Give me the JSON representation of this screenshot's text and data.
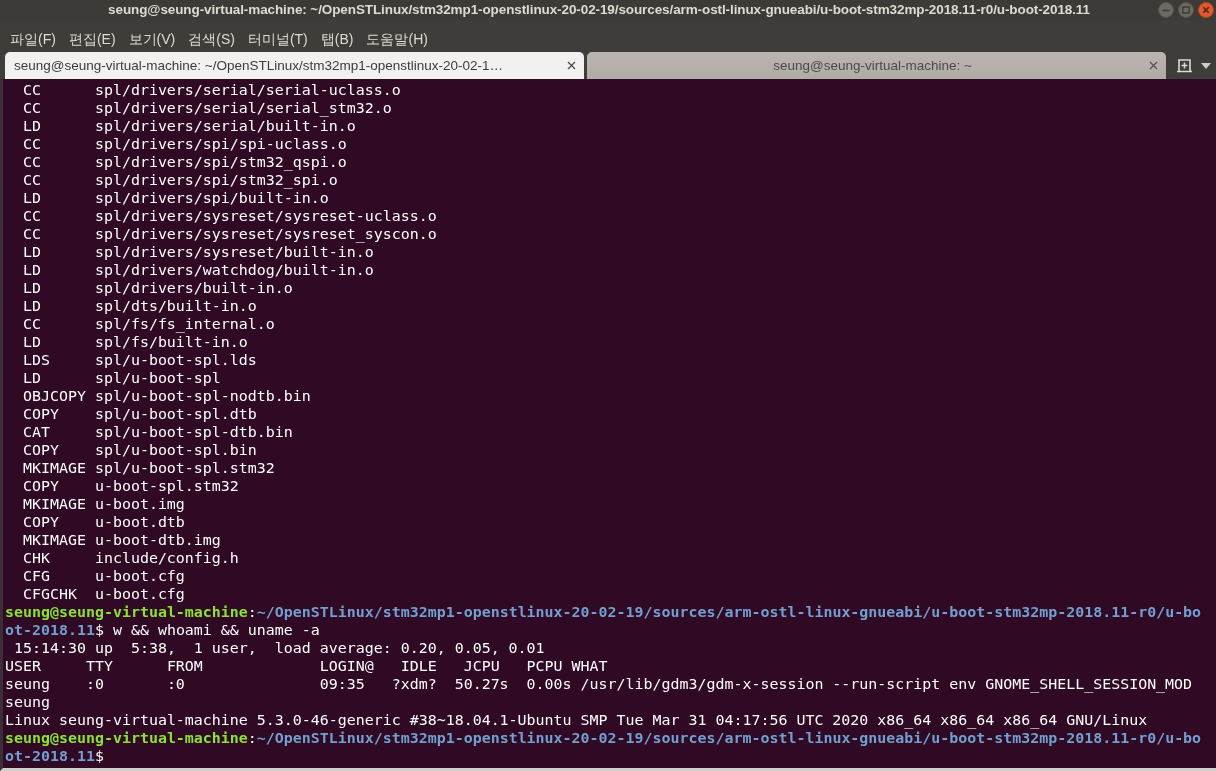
{
  "window": {
    "title": "seung@seung-virtual-machine: ~/OpenSTLinux/stm32mp1-openstlinux-20-02-19/sources/arm-ostl-linux-gnueabi/u-boot-stm32mp-2018.11-r0/u-boot-2018.11"
  },
  "menu": [
    "파일(F)",
    "편집(E)",
    "보기(V)",
    "검색(S)",
    "터미널(T)",
    "탭(B)",
    "도움말(H)"
  ],
  "tabs": [
    {
      "label": "seung@seung-virtual-machine: ~/OpenSTLinux/stm32mp1-openstlinux-20-02-1…",
      "selected": true
    },
    {
      "label": "seung@seung-virtual-machine: ~",
      "selected": false
    }
  ],
  "terminal": {
    "lines": [
      {
        "kind": "build",
        "text": "CC      spl/drivers/serial/serial-uclass.o"
      },
      {
        "kind": "build",
        "text": "CC      spl/drivers/serial/serial_stm32.o"
      },
      {
        "kind": "build",
        "text": "LD      spl/drivers/serial/built-in.o"
      },
      {
        "kind": "build",
        "text": "CC      spl/drivers/spi/spi-uclass.o"
      },
      {
        "kind": "build",
        "text": "CC      spl/drivers/spi/stm32_qspi.o"
      },
      {
        "kind": "build",
        "text": "CC      spl/drivers/spi/stm32_spi.o"
      },
      {
        "kind": "build",
        "text": "LD      spl/drivers/spi/built-in.o"
      },
      {
        "kind": "build",
        "text": "CC      spl/drivers/sysreset/sysreset-uclass.o"
      },
      {
        "kind": "build",
        "text": "CC      spl/drivers/sysreset/sysreset_syscon.o"
      },
      {
        "kind": "build",
        "text": "LD      spl/drivers/sysreset/built-in.o"
      },
      {
        "kind": "build",
        "text": "LD      spl/drivers/watchdog/built-in.o"
      },
      {
        "kind": "build",
        "text": "LD      spl/drivers/built-in.o"
      },
      {
        "kind": "build",
        "text": "LD      spl/dts/built-in.o"
      },
      {
        "kind": "build",
        "text": "CC      spl/fs/fs_internal.o"
      },
      {
        "kind": "build",
        "text": "LD      spl/fs/built-in.o"
      },
      {
        "kind": "build",
        "text": "LDS     spl/u-boot-spl.lds"
      },
      {
        "kind": "build",
        "text": "LD      spl/u-boot-spl"
      },
      {
        "kind": "build",
        "text": "OBJCOPY spl/u-boot-spl-nodtb.bin"
      },
      {
        "kind": "build",
        "text": "COPY    spl/u-boot-spl.dtb"
      },
      {
        "kind": "build",
        "text": "CAT     spl/u-boot-spl-dtb.bin"
      },
      {
        "kind": "build",
        "text": "COPY    spl/u-boot-spl.bin"
      },
      {
        "kind": "build",
        "text": "MKIMAGE spl/u-boot-spl.stm32"
      },
      {
        "kind": "build",
        "text": "COPY    u-boot-spl.stm32"
      },
      {
        "kind": "build",
        "text": "MKIMAGE u-boot.img"
      },
      {
        "kind": "build",
        "text": "COPY    u-boot.dtb"
      },
      {
        "kind": "build",
        "text": "MKIMAGE u-boot-dtb.img"
      },
      {
        "kind": "build",
        "text": "CHK     include/config.h"
      },
      {
        "kind": "build",
        "text": "CFG     u-boot.cfg"
      },
      {
        "kind": "build",
        "text": "CFGCHK  u-boot.cfg"
      },
      {
        "kind": "prompt",
        "segments": [
          {
            "kind": "user",
            "text": "seung@seung-virtual-machine"
          },
          {
            "kind": "plain",
            "text": ":"
          },
          {
            "kind": "path",
            "text": "~/OpenSTLinux/stm32mp1-openstlinux-20-02-19/sources/arm-ostl-linux-gnueabi/u-boot-stm32mp-2018.11-r0/u-bo"
          }
        ]
      },
      {
        "kind": "prompt",
        "segments": [
          {
            "kind": "path",
            "text": "ot-2018.11"
          },
          {
            "kind": "plain",
            "text": "$ w && whoami && uname -a"
          }
        ]
      },
      {
        "kind": "output",
        "text": " 15:14:30 up  5:38,  1 user,  load average: 0.20, 0.05, 0.01"
      },
      {
        "kind": "output",
        "text": "USER     TTY      FROM             LOGIN@   IDLE   JCPU   PCPU WHAT"
      },
      {
        "kind": "output",
        "text": "seung    :0       :0               09:35   ?xdm?  50.27s  0.00s /usr/lib/gdm3/gdm-x-session --run-script env GNOME_SHELL_SESSION_MOD"
      },
      {
        "kind": "output",
        "text": "seung"
      },
      {
        "kind": "output",
        "text": "Linux seung-virtual-machine 5.3.0-46-generic #38~18.04.1-Ubuntu SMP Tue Mar 31 04:17:56 UTC 2020 x86_64 x86_64 x86_64 GNU/Linux"
      },
      {
        "kind": "prompt",
        "segments": [
          {
            "kind": "user",
            "text": "seung@seung-virtual-machine"
          },
          {
            "kind": "plain",
            "text": ":"
          },
          {
            "kind": "path",
            "text": "~/OpenSTLinux/stm32mp1-openstlinux-20-02-19/sources/arm-ostl-linux-gnueabi/u-boot-stm32mp-2018.11-r0/u-bo"
          }
        ]
      },
      {
        "kind": "prompt",
        "segments": [
          {
            "kind": "path",
            "text": "ot-2018.11"
          },
          {
            "kind": "plain",
            "text": "$"
          }
        ]
      }
    ]
  }
}
